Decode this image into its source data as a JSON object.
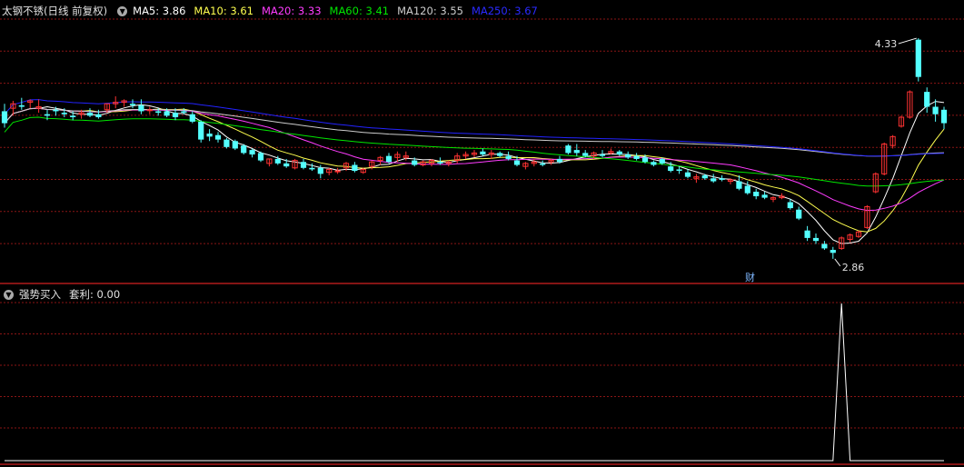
{
  "legend": {
    "title": "太钢不锈(日线 前复权)",
    "dropdown_icon": "chevron-down-icon",
    "ma5": "MA5: 3.86",
    "ma10": "MA10: 3.61",
    "ma20": "MA20: 3.33",
    "ma60": "MA60: 3.41",
    "ma120": "MA120: 3.55",
    "ma250": "MA250: 3.67"
  },
  "indicator": {
    "name": "强势买入",
    "value": "套利: 0.00"
  },
  "annotations": {
    "high_label": "4.33",
    "low_label": "2.86",
    "finance_badge": "财"
  },
  "colors": {
    "up": "#ff3232",
    "down": "#54ffff",
    "ma5": "#ffffff",
    "ma10": "#ffff4f",
    "ma20": "#ff3cff",
    "ma60": "#00e600",
    "ma120": "#cccccc",
    "ma250": "#2323ff",
    "grid": "#8b1515"
  },
  "chart_data": [
    {
      "type": "candlestick",
      "title": "太钢不锈(日线 前复权)",
      "ylim": [
        2.78,
        4.45
      ],
      "annotations": [
        {
          "label": "4.33",
          "value": 4.33
        },
        {
          "label": "2.86",
          "value": 2.86
        }
      ],
      "ohlc": [
        [
          3.85,
          3.9,
          3.74,
          3.77
        ],
        [
          3.87,
          3.92,
          3.82,
          3.9
        ],
        [
          3.89,
          3.94,
          3.86,
          3.88
        ],
        [
          3.91,
          3.93,
          3.87,
          3.92
        ],
        [
          3.87,
          3.93,
          3.84,
          3.88
        ],
        [
          3.83,
          3.86,
          3.79,
          3.82
        ],
        [
          3.86,
          3.88,
          3.82,
          3.85
        ],
        [
          3.84,
          3.87,
          3.81,
          3.83
        ],
        [
          3.82,
          3.85,
          3.79,
          3.81
        ],
        [
          3.83,
          3.86,
          3.8,
          3.84
        ],
        [
          3.84,
          3.87,
          3.81,
          3.82
        ],
        [
          3.83,
          3.86,
          3.8,
          3.81
        ],
        [
          3.86,
          3.9,
          3.84,
          3.9
        ],
        [
          3.9,
          3.95,
          3.87,
          3.91
        ],
        [
          3.91,
          3.93,
          3.88,
          3.92
        ],
        [
          3.9,
          3.93,
          3.87,
          3.89
        ],
        [
          3.89,
          3.93,
          3.83,
          3.85
        ],
        [
          3.86,
          3.88,
          3.83,
          3.86
        ],
        [
          3.85,
          3.87,
          3.82,
          3.84
        ],
        [
          3.85,
          3.87,
          3.81,
          3.82
        ],
        [
          3.84,
          3.87,
          3.79,
          3.81
        ],
        [
          3.85,
          3.87,
          3.83,
          3.84
        ],
        [
          3.83,
          3.85,
          3.77,
          3.78
        ],
        [
          3.78,
          3.79,
          3.64,
          3.66
        ],
        [
          3.7,
          3.73,
          3.65,
          3.68
        ],
        [
          3.69,
          3.71,
          3.64,
          3.66
        ],
        [
          3.66,
          3.67,
          3.6,
          3.61
        ],
        [
          3.65,
          3.66,
          3.59,
          3.6
        ],
        [
          3.62,
          3.63,
          3.56,
          3.57
        ],
        [
          3.59,
          3.6,
          3.54,
          3.56
        ],
        [
          3.57,
          3.58,
          3.51,
          3.52
        ],
        [
          3.5,
          3.53,
          3.48,
          3.53
        ],
        [
          3.53,
          3.55,
          3.49,
          3.5
        ],
        [
          3.5,
          3.53,
          3.47,
          3.48
        ],
        [
          3.47,
          3.53,
          3.46,
          3.52
        ],
        [
          3.51,
          3.53,
          3.46,
          3.47
        ],
        [
          3.47,
          3.5,
          3.45,
          3.46
        ],
        [
          3.47,
          3.49,
          3.4,
          3.43
        ],
        [
          3.44,
          3.47,
          3.42,
          3.46
        ],
        [
          3.45,
          3.47,
          3.43,
          3.45
        ],
        [
          3.47,
          3.51,
          3.45,
          3.5
        ],
        [
          3.49,
          3.51,
          3.44,
          3.45
        ],
        [
          3.44,
          3.47,
          3.43,
          3.46
        ],
        [
          3.48,
          3.52,
          3.46,
          3.51
        ],
        [
          3.52,
          3.55,
          3.49,
          3.54
        ],
        [
          3.55,
          3.57,
          3.5,
          3.51
        ],
        [
          3.54,
          3.58,
          3.51,
          3.56
        ],
        [
          3.54,
          3.58,
          3.52,
          3.55
        ],
        [
          3.52,
          3.54,
          3.48,
          3.49
        ],
        [
          3.49,
          3.52,
          3.48,
          3.51
        ],
        [
          3.5,
          3.53,
          3.48,
          3.52
        ],
        [
          3.51,
          3.54,
          3.49,
          3.5
        ],
        [
          3.5,
          3.52,
          3.48,
          3.51
        ],
        [
          3.52,
          3.57,
          3.5,
          3.55
        ],
        [
          3.55,
          3.58,
          3.53,
          3.56
        ],
        [
          3.56,
          3.59,
          3.54,
          3.57
        ],
        [
          3.58,
          3.6,
          3.55,
          3.56
        ],
        [
          3.56,
          3.59,
          3.53,
          3.57
        ],
        [
          3.57,
          3.58,
          3.54,
          3.55
        ],
        [
          3.55,
          3.58,
          3.52,
          3.53
        ],
        [
          3.52,
          3.55,
          3.48,
          3.49
        ],
        [
          3.48,
          3.51,
          3.46,
          3.5
        ],
        [
          3.5,
          3.53,
          3.48,
          3.51
        ],
        [
          3.5,
          3.52,
          3.48,
          3.49
        ],
        [
          3.51,
          3.53,
          3.49,
          3.52
        ],
        [
          3.53,
          3.55,
          3.5,
          3.51
        ],
        [
          3.62,
          3.63,
          3.56,
          3.57
        ],
        [
          3.59,
          3.63,
          3.55,
          3.57
        ],
        [
          3.57,
          3.59,
          3.54,
          3.55
        ],
        [
          3.55,
          3.58,
          3.53,
          3.57
        ],
        [
          3.56,
          3.59,
          3.54,
          3.55
        ],
        [
          3.57,
          3.6,
          3.56,
          3.58
        ],
        [
          3.58,
          3.59,
          3.55,
          3.56
        ],
        [
          3.56,
          3.58,
          3.53,
          3.54
        ],
        [
          3.55,
          3.57,
          3.52,
          3.53
        ],
        [
          3.54,
          3.56,
          3.5,
          3.51
        ],
        [
          3.51,
          3.52,
          3.48,
          3.49
        ],
        [
          3.53,
          3.54,
          3.49,
          3.5
        ],
        [
          3.48,
          3.51,
          3.44,
          3.45
        ],
        [
          3.46,
          3.48,
          3.43,
          3.45
        ],
        [
          3.44,
          3.46,
          3.4,
          3.41
        ],
        [
          3.4,
          3.43,
          3.37,
          3.41
        ],
        [
          3.42,
          3.43,
          3.39,
          3.4
        ],
        [
          3.4,
          3.43,
          3.37,
          3.38
        ],
        [
          3.4,
          3.42,
          3.38,
          3.39
        ],
        [
          3.38,
          3.4,
          3.36,
          3.39
        ],
        [
          3.38,
          3.42,
          3.32,
          3.33
        ],
        [
          3.35,
          3.38,
          3.29,
          3.3
        ],
        [
          3.31,
          3.33,
          3.26,
          3.28
        ],
        [
          3.29,
          3.31,
          3.26,
          3.27
        ],
        [
          3.26,
          3.28,
          3.24,
          3.27
        ],
        [
          3.27,
          3.3,
          3.26,
          3.28
        ],
        [
          3.24,
          3.26,
          3.19,
          3.2
        ],
        [
          3.19,
          3.21,
          3.12,
          3.13
        ],
        [
          3.05,
          3.08,
          2.98,
          3.0
        ],
        [
          3.0,
          3.03,
          2.96,
          2.98
        ],
        [
          2.96,
          2.98,
          2.92,
          2.93
        ],
        [
          2.92,
          2.94,
          2.86,
          2.9
        ],
        [
          2.93,
          3.01,
          2.92,
          3.0
        ],
        [
          2.99,
          3.03,
          2.97,
          3.02
        ],
        [
          3.01,
          3.05,
          3.0,
          3.04
        ],
        [
          3.07,
          3.22,
          3.06,
          3.21
        ],
        [
          3.31,
          3.44,
          3.3,
          3.43
        ],
        [
          3.43,
          3.64,
          3.42,
          3.63
        ],
        [
          3.62,
          3.69,
          3.6,
          3.68
        ],
        [
          3.75,
          3.82,
          3.74,
          3.81
        ],
        [
          3.81,
          3.99,
          3.8,
          3.98
        ],
        [
          4.33,
          4.34,
          4.05,
          4.08
        ],
        [
          3.98,
          4.01,
          3.84,
          3.88
        ],
        [
          3.88,
          3.93,
          3.78,
          3.83
        ],
        [
          3.86,
          3.88,
          3.73,
          3.77
        ]
      ],
      "series": [
        {
          "name": "MA5",
          "last": 3.86
        },
        {
          "name": "MA10",
          "last": 3.61
        },
        {
          "name": "MA20",
          "last": 3.33
        },
        {
          "name": "MA60",
          "last": 3.41
        },
        {
          "name": "MA120",
          "last": 3.55
        },
        {
          "name": "MA250",
          "last": 3.67
        }
      ]
    },
    {
      "type": "line",
      "title": "强势买入",
      "ylim": [
        0,
        1
      ],
      "series": [
        {
          "name": "套利",
          "values": [
            0,
            0,
            0,
            0,
            0,
            0,
            0,
            0,
            0,
            0,
            0,
            0,
            0,
            0,
            0,
            0,
            0,
            0,
            0,
            0,
            0,
            0,
            0,
            0,
            0,
            0,
            0,
            0,
            0,
            0,
            0,
            0,
            0,
            0,
            0,
            0,
            0,
            0,
            0,
            0,
            0,
            0,
            0,
            0,
            0,
            0,
            0,
            0,
            0,
            0,
            0,
            0,
            0,
            0,
            0,
            0,
            0,
            0,
            0,
            0,
            0,
            0,
            0,
            0,
            0,
            0,
            0,
            0,
            0,
            0,
            0,
            0,
            0,
            0,
            0,
            0,
            0,
            0,
            0,
            0,
            0,
            0,
            0,
            0,
            0,
            0,
            0,
            0,
            0,
            0,
            0,
            0,
            0,
            0,
            0,
            0,
            0,
            0,
            1,
            0,
            0,
            0,
            0,
            0,
            0,
            0,
            0,
            0,
            0,
            0,
            0
          ]
        }
      ]
    }
  ]
}
